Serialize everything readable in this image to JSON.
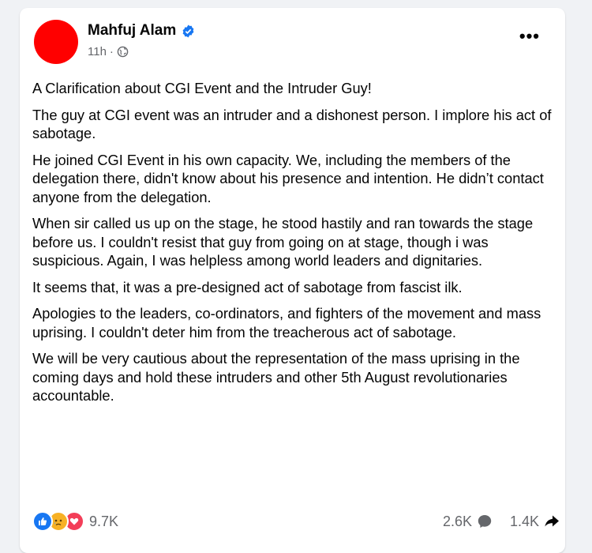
{
  "post": {
    "author": "Mahfuj Alam",
    "time": "11h",
    "separator": "·",
    "more_icon": "more-options-icon",
    "paragraphs": [
      "A Clarification about CGI Event and the Intruder Guy!",
      "The guy at CGI event was an intruder and a dishonest person. I implore his act of sabotage.",
      "He joined CGI Event in his own capacity. We, including the members of the delegation there, didn't know about his presence and intention. He didn’t contact anyone from the delegation.",
      "When sir called us up on the stage, he stood hastily and ran towards the stage before us. I couldn't resist that guy from going on at stage, though i was suspicious. Again, I was helpless among world leaders and dignitaries.",
      "It seems that, it was a pre-designed act of sabotage from fascist ilk.",
      "Apologies to the leaders, co-ordinators, and fighters of the movement and mass uprising. I couldn't deter him from the treacherous act of sabotage.",
      "We will be very cautious about the representation of the mass uprising in the coming days and hold these intruders and other 5th August revolutionaries accountable."
    ]
  },
  "footer": {
    "reaction_count": "9.7K",
    "comment_count": "2.6K",
    "share_count": "1.4K",
    "reaction_icons": [
      "like-icon",
      "sad-icon",
      "love-icon"
    ]
  },
  "colors": {
    "avatar": "#ff0000",
    "verified": "#1877f2",
    "background": "#f0f2f5",
    "secondary_text": "#65676b"
  }
}
